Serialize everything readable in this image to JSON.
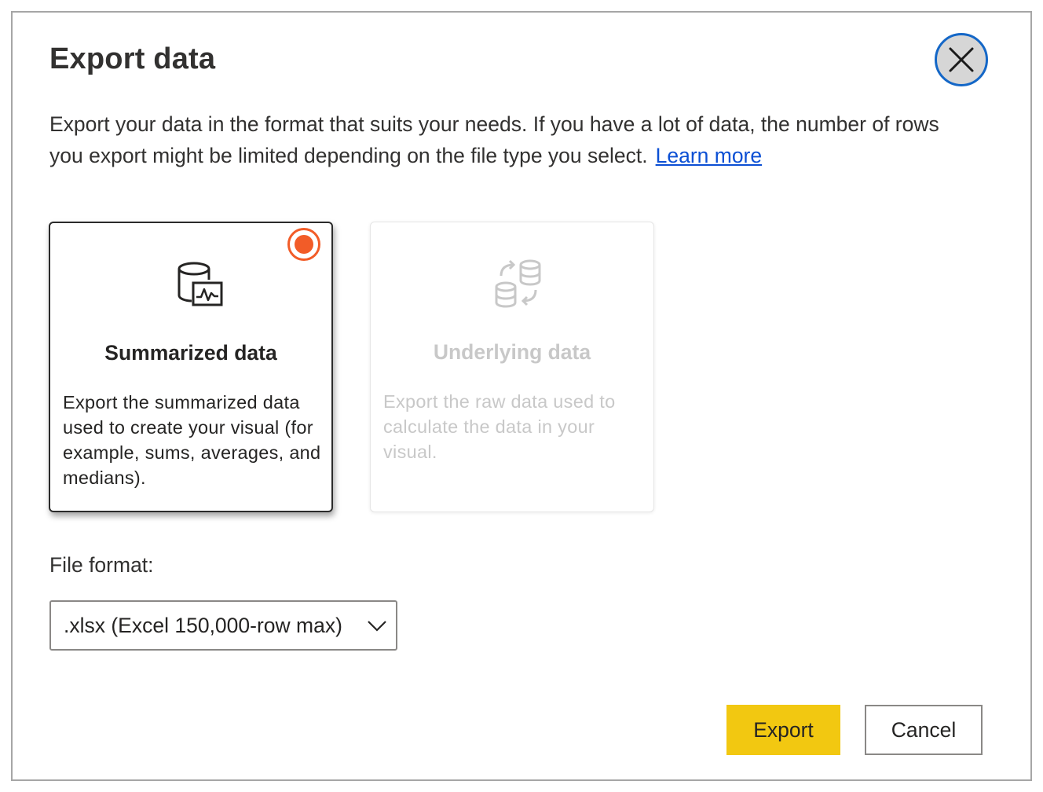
{
  "dialog": {
    "title": "Export data",
    "description": "Export your data in the format that suits your needs. If you have a lot of data, the number of rows you export might be limited depending on the file type you select.",
    "learn_more_link": "Learn more"
  },
  "options": [
    {
      "title": "Summarized data",
      "description": "Export the summarized data used to create your visual (for example, sums, averages, and medians).",
      "selected": true,
      "enabled": true,
      "icon": "database-chart-icon"
    },
    {
      "title": "Underlying data",
      "description": "Export the raw data used to calculate the data in your visual.",
      "selected": false,
      "enabled": false,
      "icon": "database-sync-icon"
    }
  ],
  "file_format": {
    "label": "File format:",
    "selected": ".xlsx (Excel 150,000-row max)"
  },
  "buttons": {
    "export": "Export",
    "cancel": "Cancel"
  },
  "colors": {
    "accent_radio": "#f25c28",
    "export_button": "#f2c811",
    "close_focus_ring": "#1467c7",
    "link": "#0b4fd4"
  }
}
